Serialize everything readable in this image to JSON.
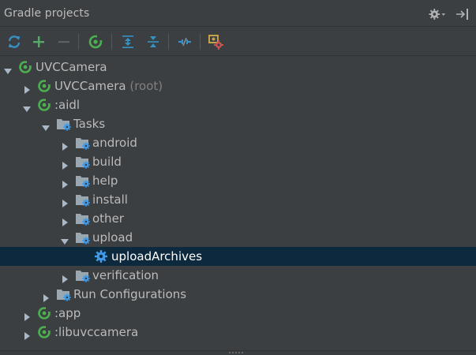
{
  "panel": {
    "title": "Gradle projects"
  },
  "header_icons": [
    {
      "name": "gear-icon"
    },
    {
      "name": "hide-panel-icon"
    }
  ],
  "toolbar": [
    {
      "name": "refresh-all-button",
      "icon": "refresh-icon"
    },
    {
      "name": "add-project-button",
      "icon": "plus-icon"
    },
    {
      "name": "remove-project-button",
      "icon": "minus-icon"
    },
    {
      "name": "execute-task-button",
      "icon": "gradle-icon"
    },
    {
      "name": "expand-all-button",
      "icon": "expand-all-icon"
    },
    {
      "name": "collapse-all-button",
      "icon": "collapse-all-icon"
    },
    {
      "name": "offline-mode-button",
      "icon": "offline-icon"
    },
    {
      "name": "gradle-settings-button",
      "icon": "gradle-settings-icon"
    }
  ],
  "tree": [
    {
      "label": "UVCCamera",
      "suffix": "",
      "depth": 0,
      "expanded": true,
      "has_children": true,
      "icon": "gradle-module"
    },
    {
      "label": "UVCCamera",
      "suffix": " (root)",
      "depth": 1,
      "expanded": false,
      "has_children": true,
      "icon": "gradle-module"
    },
    {
      "label": ":aidl",
      "suffix": "",
      "depth": 1,
      "expanded": true,
      "has_children": true,
      "icon": "gradle-module"
    },
    {
      "label": "Tasks",
      "suffix": "",
      "depth": 2,
      "expanded": true,
      "has_children": true,
      "icon": "folder-gear"
    },
    {
      "label": "android",
      "suffix": "",
      "depth": 3,
      "expanded": false,
      "has_children": true,
      "icon": "folder-gear"
    },
    {
      "label": "build",
      "suffix": "",
      "depth": 3,
      "expanded": false,
      "has_children": true,
      "icon": "folder-gear"
    },
    {
      "label": "help",
      "suffix": "",
      "depth": 3,
      "expanded": false,
      "has_children": true,
      "icon": "folder-gear"
    },
    {
      "label": "install",
      "suffix": "",
      "depth": 3,
      "expanded": false,
      "has_children": true,
      "icon": "folder-gear"
    },
    {
      "label": "other",
      "suffix": "",
      "depth": 3,
      "expanded": false,
      "has_children": true,
      "icon": "folder-gear"
    },
    {
      "label": "upload",
      "suffix": "",
      "depth": 3,
      "expanded": true,
      "has_children": true,
      "icon": "folder-gear"
    },
    {
      "label": "uploadArchives",
      "suffix": "",
      "depth": 4,
      "expanded": false,
      "has_children": false,
      "icon": "gear",
      "selected": true
    },
    {
      "label": "verification",
      "suffix": "",
      "depth": 3,
      "expanded": false,
      "has_children": true,
      "icon": "folder-gear"
    },
    {
      "label": "Run Configurations",
      "suffix": "",
      "depth": 2,
      "expanded": false,
      "has_children": true,
      "icon": "folder-gear"
    },
    {
      "label": ":app",
      "suffix": "",
      "depth": 1,
      "expanded": false,
      "has_children": true,
      "icon": "gradle-module"
    },
    {
      "label": ":libuvccamera",
      "suffix": "",
      "depth": 1,
      "expanded": false,
      "has_children": true,
      "icon": "gradle-module"
    }
  ],
  "colors": {
    "background": "#3c3f41",
    "selection": "#0d293e",
    "text": "#bbbbbb",
    "gradle_green": "#4caf50",
    "gear_blue": "#3d9be9",
    "toolbar_blue": "#3592c4",
    "folder": "#9aa7b0"
  }
}
